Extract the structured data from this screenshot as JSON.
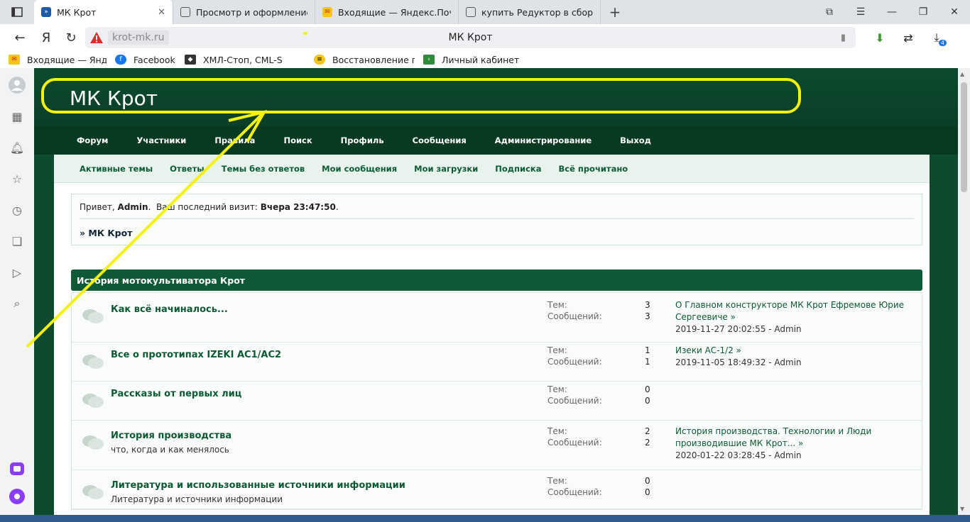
{
  "browser": {
    "tabs": [
      {
        "title": "МК Крот",
        "active": true,
        "favicon_color": "#1e5aa8"
      },
      {
        "title": "Просмотр и оформление з",
        "active": false,
        "favicon_color": "#ffffff"
      },
      {
        "title": "Входящие — Яндекс.Почта",
        "active": false,
        "favicon_color": "#f5c518"
      },
      {
        "title": "купить Редуктор в сборе V",
        "active": false,
        "favicon_color": "#ffffff"
      }
    ],
    "url": "krot-mk.ru",
    "page_title": "МК Крот",
    "yandex_logo": "Я",
    "downloads_count": "4",
    "bookmarks": [
      {
        "label": "Входящие — Янде",
        "icon": "mail-icon",
        "color": "#f5c518"
      },
      {
        "label": "Facebook",
        "icon": "facebook-icon",
        "color": "#1877f2"
      },
      {
        "label": "ХМЛ-Стоп, CML-S",
        "icon": "xml-icon",
        "color": "#333333"
      },
      {
        "label": "Восстановление п",
        "icon": "beeline-icon",
        "color": "#f5c518"
      },
      {
        "label": "Личный кабинет",
        "icon": "cabinet-icon",
        "color": "#2e8b3a"
      }
    ]
  },
  "site": {
    "title": "МК Крот",
    "nav": [
      "Форум",
      "Участники",
      "Правила",
      "Поиск",
      "Профиль",
      "Сообщения",
      "Администрирование",
      "Выход"
    ],
    "subnav": [
      "Активные темы",
      "Ответы",
      "Темы без ответов",
      "Мои сообщения",
      "Мои загрузки",
      "Подписка",
      "Всё прочитано"
    ],
    "welcome": {
      "greeting": "Привет,",
      "user": "Admin",
      "last_visit_label": "Ваш последний визит:",
      "last_visit": "Вчера 23:47:50",
      "breadcrumb": "» МК Крот"
    },
    "category": "История мотокультиватора Крот",
    "labels": {
      "topics": "Тем:",
      "posts": "Сообщений:"
    },
    "forums": [
      {
        "name": "Как всё начиналось...",
        "desc": "",
        "topics": "3",
        "posts": "3",
        "last_title": "О Главном конструкторе МК Крот Ефремове Юрие Сергеевиче »",
        "last_meta": "2019-11-27 20:02:55 - Admin"
      },
      {
        "name": "Все о прототипах IZEKI AC1/AC2",
        "desc": "",
        "topics": "1",
        "posts": "1",
        "last_title": "Изеки АС-1/2 »",
        "last_meta": "2019-11-05 18:49:32 - Admin"
      },
      {
        "name": "Рассказы от первых лиц",
        "desc": "",
        "topics": "0",
        "posts": "0",
        "last_title": "",
        "last_meta": ""
      },
      {
        "name": "История производства",
        "desc": "что, когда и как менялось",
        "topics": "2",
        "posts": "2",
        "last_title": "История производства. Технологии и Люди производившие МК Крот... »",
        "last_meta": "2020-01-22 03:28:45 - Admin"
      },
      {
        "name": "Литература и использованные источники информации",
        "desc": "Литература и источники информации",
        "topics": "0",
        "posts": "0",
        "last_title": "",
        "last_meta": ""
      }
    ]
  },
  "colors": {
    "header_green": "#0c4a2e",
    "annotation_yellow": "#f5f20a"
  }
}
